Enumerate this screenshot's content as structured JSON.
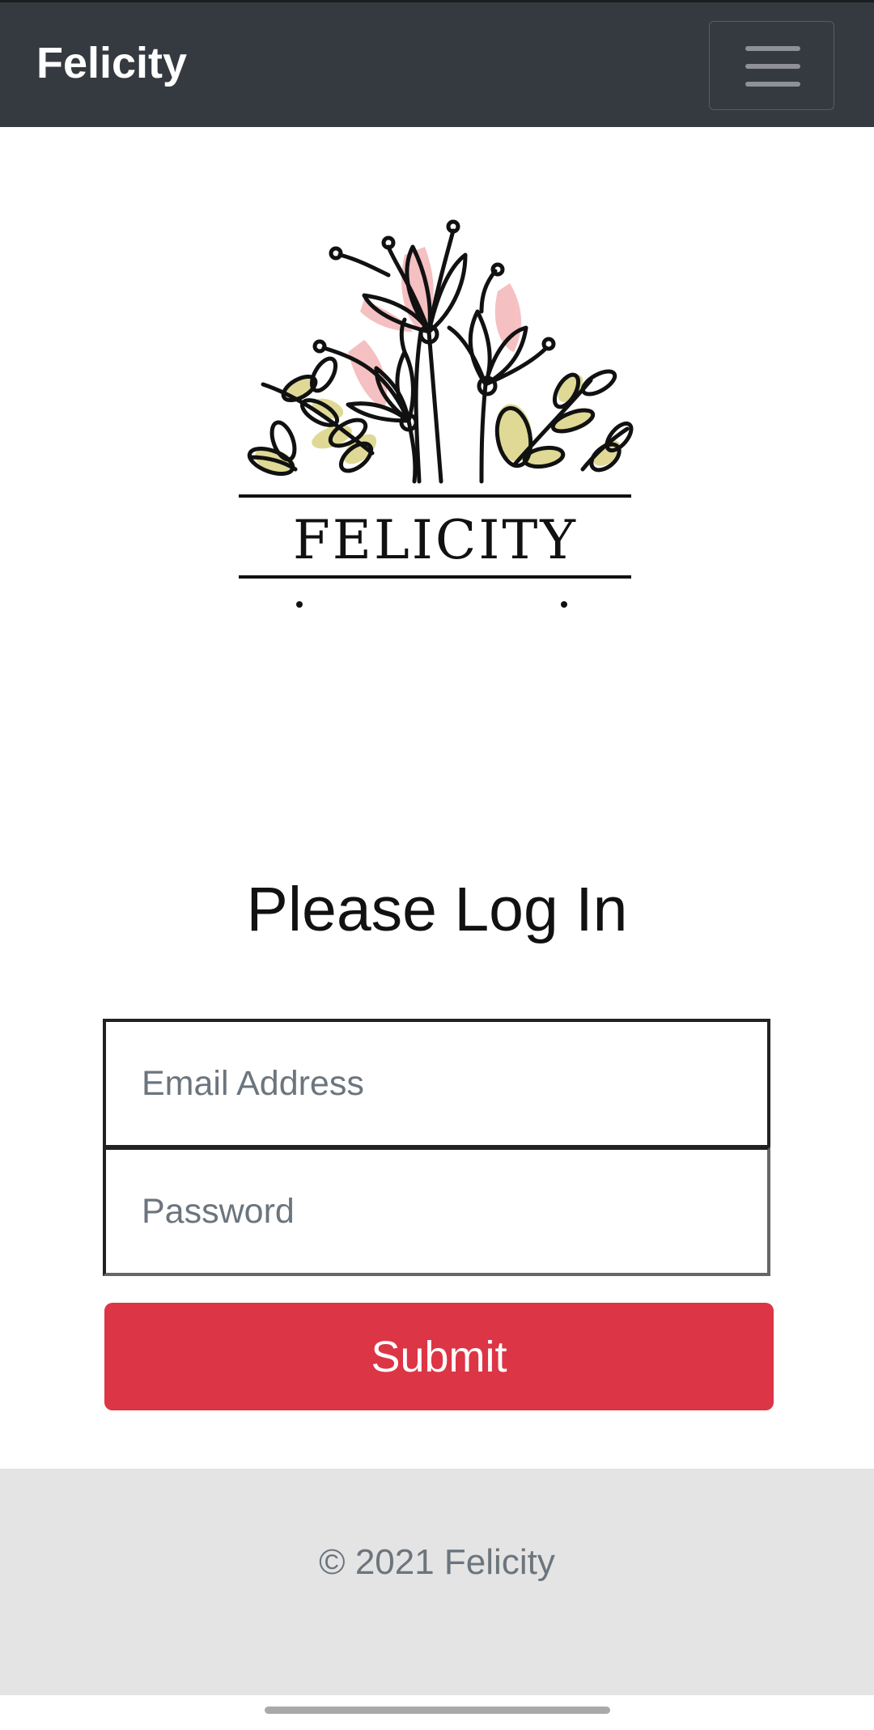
{
  "navbar": {
    "brand": "Felicity",
    "menu_icon": "hamburger-menu-icon"
  },
  "logo": {
    "text": "FELICITY",
    "colors": {
      "petal": "#f4b6b8",
      "leaf": "#dcd58a",
      "ink": "#111111"
    }
  },
  "login": {
    "title": "Please Log In",
    "email_placeholder": "Email Address",
    "password_placeholder": "Password",
    "submit_label": "Submit"
  },
  "footer": {
    "text": "© 2021 Felicity"
  },
  "colors": {
    "navbar_bg": "#343a40",
    "submit_bg": "#dc3545",
    "footer_bg": "#e4e4e4"
  }
}
